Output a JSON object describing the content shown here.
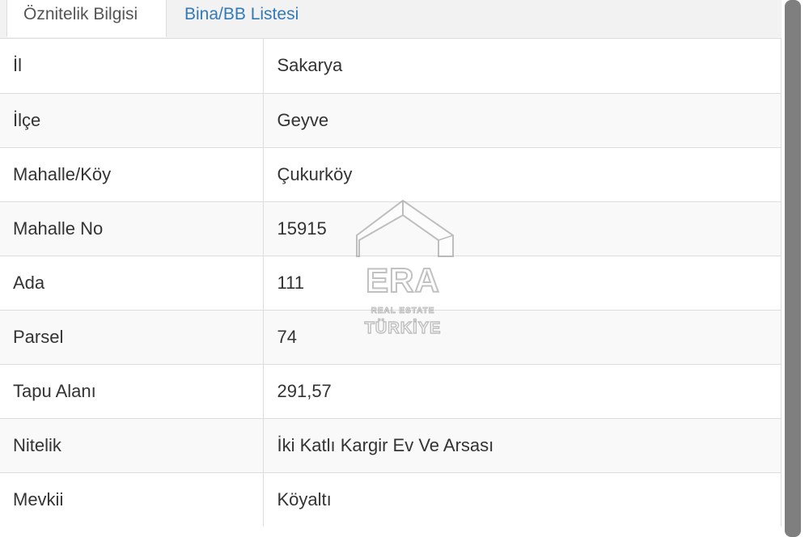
{
  "tabs": [
    {
      "label": "Öznitelik Bilgisi",
      "active": true
    },
    {
      "label": "Bina/BB Listesi",
      "active": false
    }
  ],
  "rows": [
    {
      "key": "İl",
      "value": "Sakarya"
    },
    {
      "key": "İlçe",
      "value": "Geyve"
    },
    {
      "key": "Mahalle/Köy",
      "value": "Çukurköy"
    },
    {
      "key": "Mahalle No",
      "value": "15915"
    },
    {
      "key": "Ada",
      "value": "111"
    },
    {
      "key": "Parsel",
      "value": "74"
    },
    {
      "key": "Tapu Alanı",
      "value": "291,57"
    },
    {
      "key": "Nitelik",
      "value": "İki Katlı Kargir Ev Ve Arsası"
    },
    {
      "key": "Mevkii",
      "value": "Köyaltı"
    }
  ],
  "watermark": {
    "brand": "ERA",
    "line1": "REAL ESTATE",
    "line2": "TÜRKİYE",
    "registered_mark": "®"
  },
  "colors": {
    "link": "#337ab7",
    "border": "#dddddd",
    "scrollbar": "#7f7f7f"
  }
}
